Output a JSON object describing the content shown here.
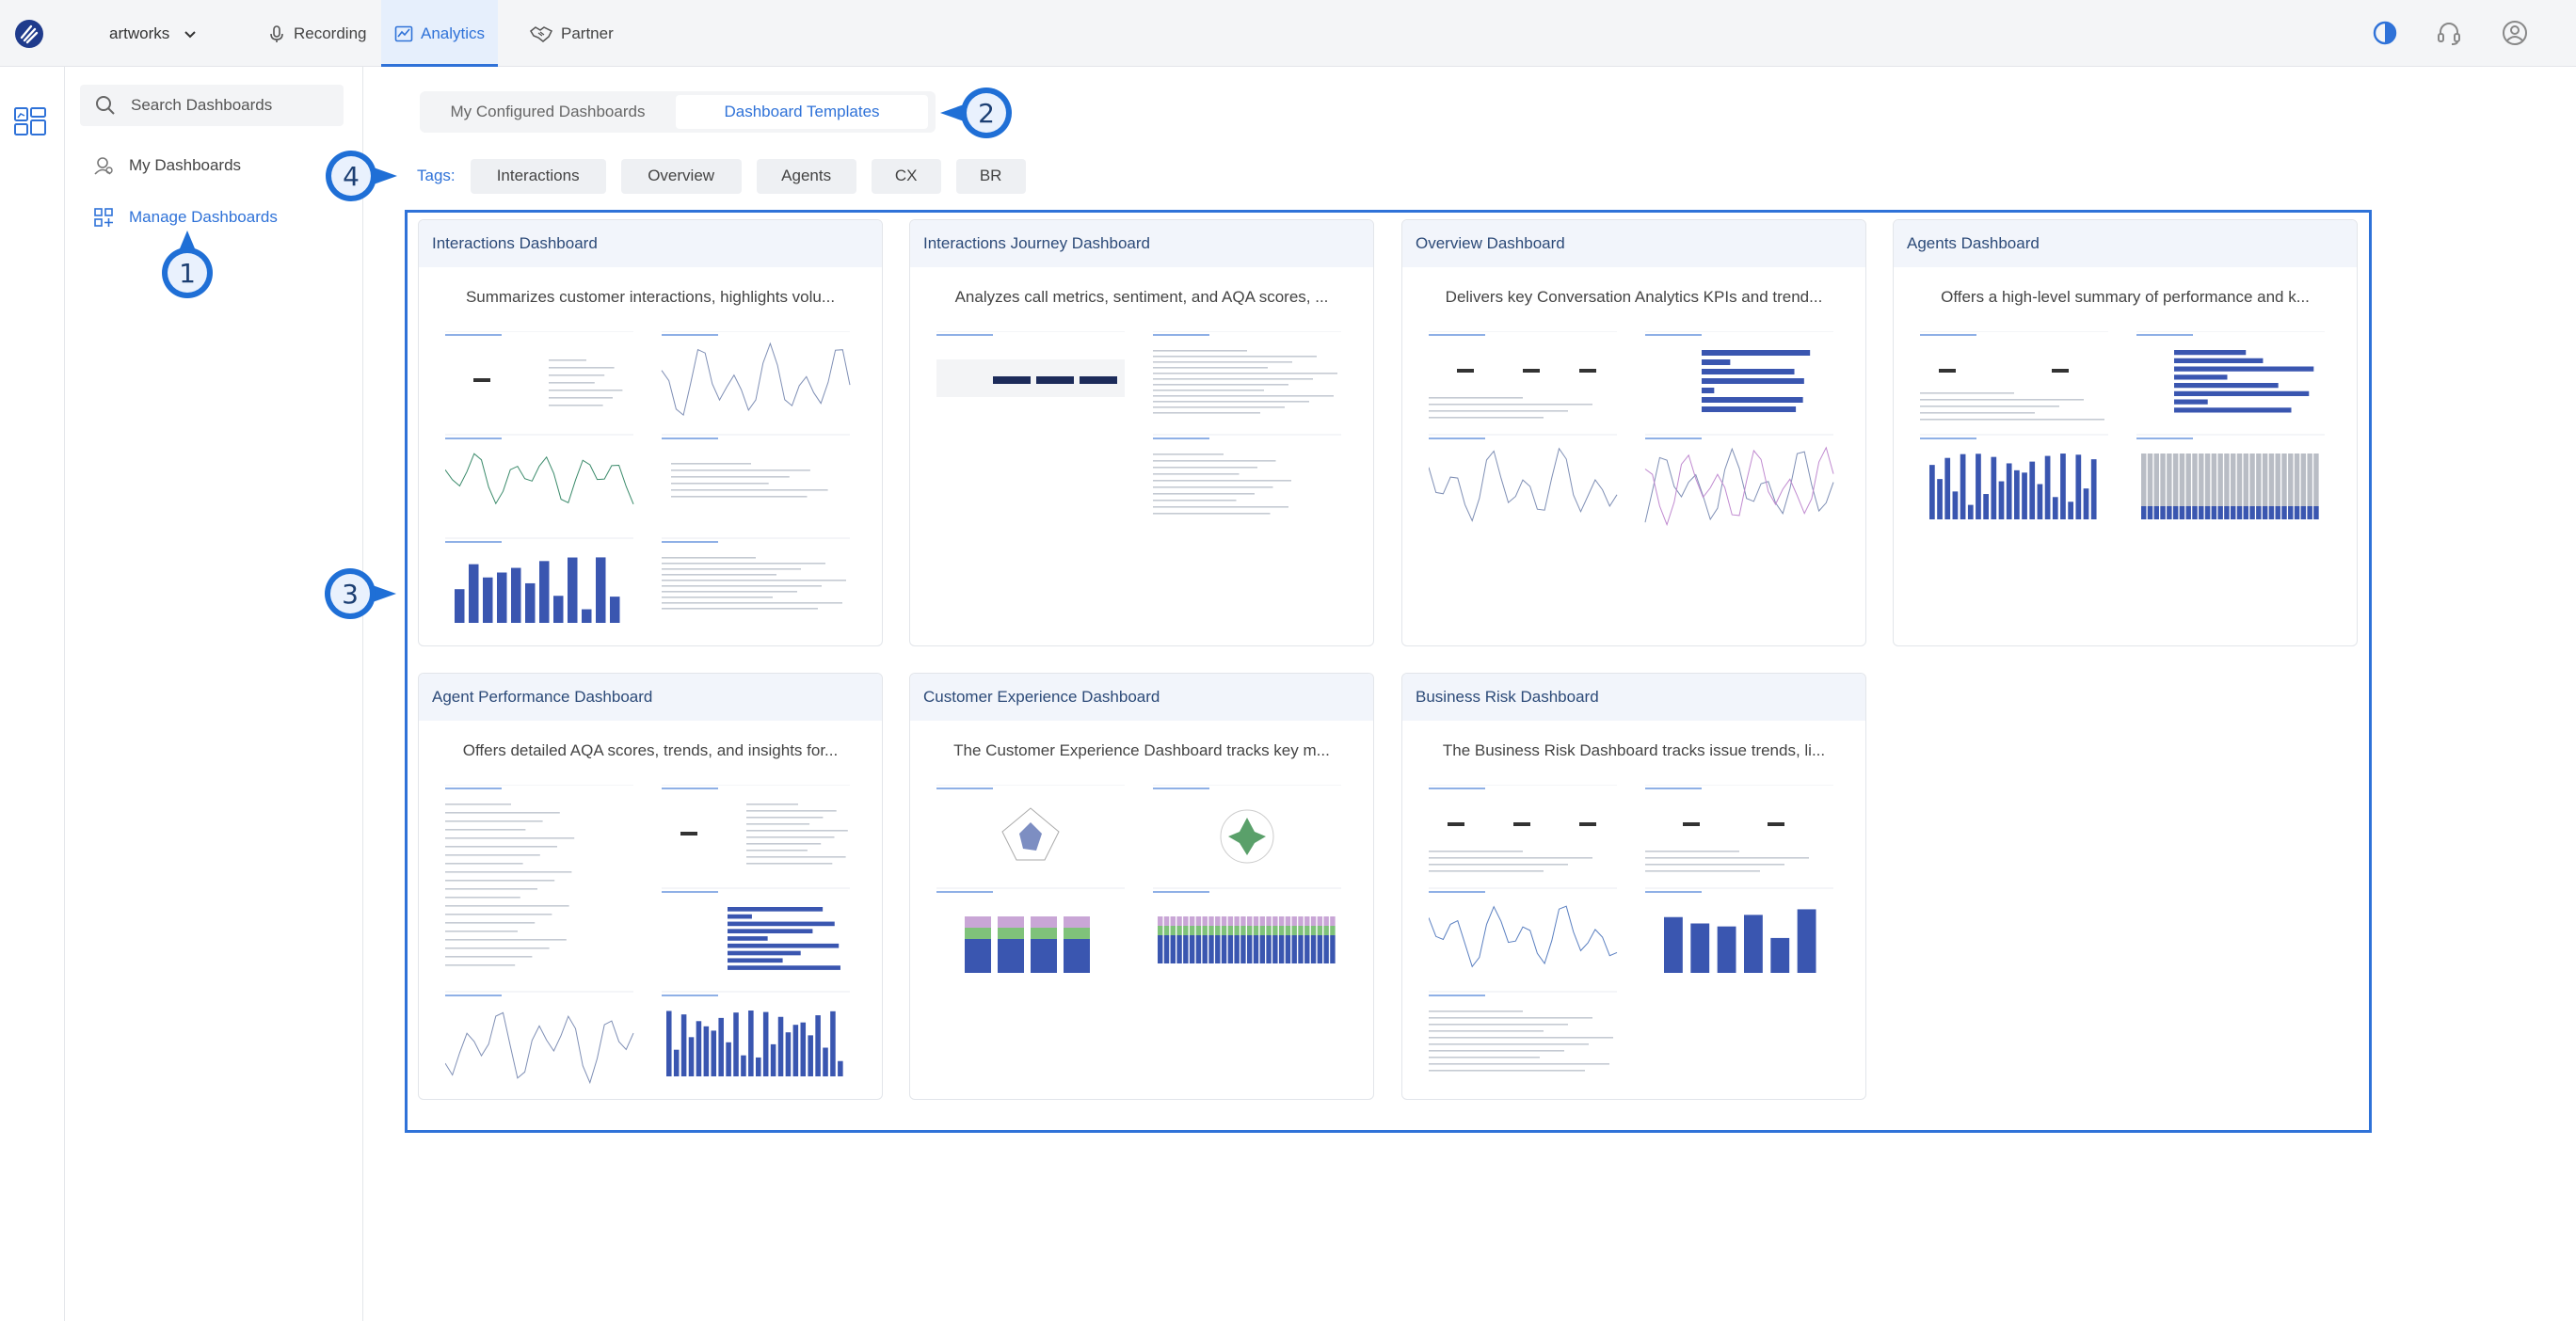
{
  "topbar": {
    "tenant": "artworks",
    "nav": [
      {
        "label": "Recording",
        "icon": "mic-icon"
      },
      {
        "label": "Analytics",
        "icon": "chart-line-icon"
      },
      {
        "label": "Partner",
        "icon": "handshake-icon"
      }
    ],
    "icons": [
      "contrast-icon",
      "headset-icon",
      "user-icon"
    ]
  },
  "sidebar": {
    "search_placeholder": "Search Dashboards",
    "items": [
      {
        "label": "My Dashboards",
        "icon": "user-dashboard-icon"
      },
      {
        "label": "Manage Dashboards",
        "icon": "grid-plus-icon"
      }
    ]
  },
  "tabs": [
    {
      "label": "My Configured Dashboards"
    },
    {
      "label": "Dashboard Templates"
    }
  ],
  "tags": {
    "label": "Tags:",
    "items": [
      "Interactions",
      "Overview",
      "Agents",
      "CX",
      "BR"
    ]
  },
  "callouts": [
    "1",
    "2",
    "3",
    "4"
  ],
  "cards": [
    {
      "title": "Interactions Dashboard",
      "description": "Summarizes customer interactions, highlights volu..."
    },
    {
      "title": "Interactions Journey Dashboard",
      "description": "Analyzes call metrics, sentiment, and AQA scores, ..."
    },
    {
      "title": "Overview Dashboard",
      "description": "Delivers key Conversation Analytics KPIs and trend..."
    },
    {
      "title": "Agents Dashboard",
      "description": "Offers a high-level summary of performance and k..."
    },
    {
      "title": "Agent Performance Dashboard",
      "description": "Offers detailed AQA scores, trends, and insights for..."
    },
    {
      "title": "Customer Experience Dashboard",
      "description": "The Customer Experience Dashboard tracks key m..."
    },
    {
      "title": "Business Risk Dashboard",
      "description": "The Business Risk Dashboard tracks issue trends, li..."
    }
  ],
  "colors": {
    "accent": "#2f72d8",
    "callout": "#1f6fd6",
    "bar": "#3a56b0"
  }
}
